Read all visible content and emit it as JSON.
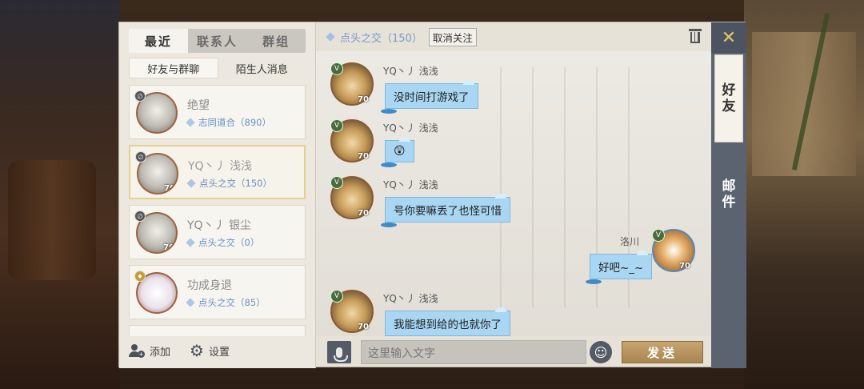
{
  "tabs": [
    {
      "label": "最近",
      "active": true
    },
    {
      "label": "联系人",
      "active": false
    },
    {
      "label": "群组",
      "active": false
    }
  ],
  "subtabs": [
    {
      "label": "好友与群聊",
      "active": true
    },
    {
      "label": "陌生人消息",
      "active": false
    }
  ],
  "contacts": [
    {
      "name": "绝望",
      "relation": "志同道合（890）",
      "level": "",
      "badge": "gray"
    },
    {
      "name": "YQ丶丿 浅浅",
      "relation": "点头之交（150）",
      "level": "70",
      "badge": "gray",
      "selected": true
    },
    {
      "name": "YQ丶丿 银尘",
      "relation": "点头之交（0）",
      "level": "70",
      "badge": "gray"
    },
    {
      "name": "功成身退",
      "relation": "点头之交（85）",
      "level": "",
      "badge": "gold"
    }
  ],
  "footer": {
    "add_label": "添加",
    "settings_label": "设置"
  },
  "header": {
    "relation": "点头之交（150）",
    "unfollow_label": "取消关注"
  },
  "messages": [
    {
      "sender": "YQ丶丿 浅浅",
      "text": "没时间打游戏了",
      "level": "70",
      "side": "left"
    },
    {
      "sender": "YQ丶丿 浅浅",
      "text": "😲",
      "level": "70",
      "side": "left"
    },
    {
      "sender": "YQ丶丿 浅浅",
      "text": "号你要嘛丢了也怪可惜",
      "level": "70",
      "side": "left"
    },
    {
      "sender": "洛川",
      "text": "好吧~_~",
      "level": "70",
      "side": "right"
    },
    {
      "sender": "YQ丶丿 浅浅",
      "text": "我能想到给的也就你了",
      "level": "70",
      "side": "left"
    }
  ],
  "input": {
    "placeholder": "这里输入文字",
    "send_label": "发送"
  },
  "rail": {
    "close_icon": "close-x",
    "tab_friends": "好友",
    "tab_mail": "邮件"
  },
  "colors": {
    "accent_gold": "#e7c46a",
    "bubble_blue": "#a9d6f2",
    "relation_blue": "#6a8fc4",
    "send_button": "#b8945f"
  }
}
